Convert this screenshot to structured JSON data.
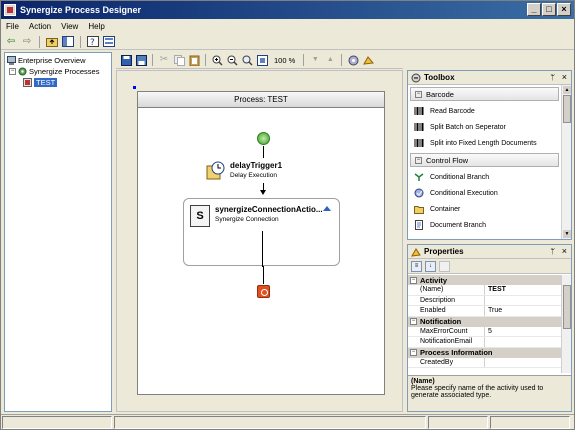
{
  "window": {
    "title": "Synergize Process Designer",
    "buttons": [
      "_",
      "□",
      "×"
    ]
  },
  "menu": {
    "file": "File",
    "action": "Action",
    "view": "View",
    "help": "Help"
  },
  "tree": {
    "items": [
      {
        "label": "Enterprise Overview",
        "icon": "computer-icon"
      },
      {
        "label": "Synergize Processes",
        "icon": "gears-icon"
      },
      {
        "label": "TEST",
        "icon": "process-icon",
        "selected": true
      }
    ]
  },
  "designer": {
    "zoom": "100 %",
    "process_title": "Process: TEST",
    "delay": {
      "title": "delayTrigger1",
      "subtitle": "Delay Execution"
    },
    "connection": {
      "title": "synergizeConnectionActio...",
      "subtitle": "Synergize Connection",
      "icon_text": "S"
    }
  },
  "toolbox": {
    "title": "Toolbox",
    "pin": "ᛘ",
    "close": "×",
    "categories": [
      {
        "name": "Barcode",
        "items": [
          {
            "label": "Read Barcode",
            "icon": "barcode-icon"
          },
          {
            "label": "Split Batch on Seperator",
            "icon": "barcode-icon"
          },
          {
            "label": "Split into Fixed Length Documents",
            "icon": "barcode-icon"
          }
        ]
      },
      {
        "name": "Control Flow",
        "items": [
          {
            "label": "Conditional Branch",
            "icon": "branch-icon"
          },
          {
            "label": "Conditional Execution",
            "icon": "execution-icon"
          },
          {
            "label": "Container",
            "icon": "folder-icon"
          },
          {
            "label": "Document Branch",
            "icon": "document-icon"
          }
        ]
      }
    ]
  },
  "properties": {
    "title": "Properties",
    "pin": "ᛘ",
    "close": "×",
    "categories": [
      {
        "name": "Activity",
        "rows": [
          {
            "name": "(Name)",
            "value": "TEST",
            "bold": true
          },
          {
            "name": "Description",
            "value": ""
          },
          {
            "name": "Enabled",
            "value": "True"
          }
        ]
      },
      {
        "name": "Notification",
        "rows": [
          {
            "name": "MaxErrorCount",
            "value": "5"
          },
          {
            "name": "NotificationEmail",
            "value": ""
          }
        ]
      },
      {
        "name": "Process Information",
        "rows": [
          {
            "name": "CreatedBy",
            "value": ""
          }
        ]
      }
    ],
    "description_title": "(Name)",
    "description_text": "Please specify name of the activity used to generate associated type."
  }
}
